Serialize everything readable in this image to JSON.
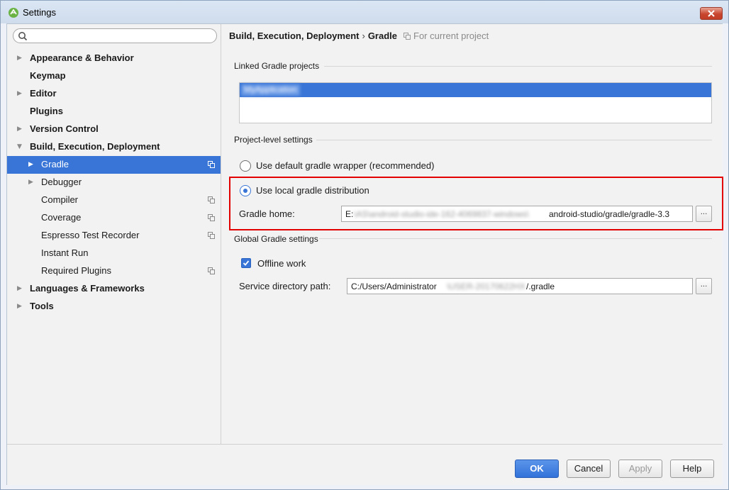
{
  "window": {
    "title": "Settings"
  },
  "search": {
    "placeholder": ""
  },
  "sidebar": {
    "items": [
      {
        "label": "Appearance & Behavior",
        "arrow": "▶"
      },
      {
        "label": "Keymap",
        "arrow": ""
      },
      {
        "label": "Editor",
        "arrow": "▶"
      },
      {
        "label": "Plugins",
        "arrow": ""
      },
      {
        "label": "Version Control",
        "arrow": "▶"
      },
      {
        "label": "Build, Execution, Deployment",
        "arrow": "▼"
      },
      {
        "label": "Gradle",
        "arrow": "▶"
      },
      {
        "label": "Debugger",
        "arrow": "▶"
      },
      {
        "label": "Compiler",
        "arrow": ""
      },
      {
        "label": "Coverage",
        "arrow": ""
      },
      {
        "label": "Espresso Test Recorder",
        "arrow": ""
      },
      {
        "label": "Instant Run",
        "arrow": ""
      },
      {
        "label": "Required Plugins",
        "arrow": ""
      },
      {
        "label": "Languages & Frameworks",
        "arrow": "▶"
      },
      {
        "label": "Tools",
        "arrow": "▶"
      }
    ]
  },
  "breadcrumb": {
    "parent": "Build, Execution, Deployment",
    "separator": "›",
    "current": "Gradle",
    "scope": "For current project"
  },
  "linked": {
    "heading": "Linked Gradle projects",
    "project_name": "MyApplication"
  },
  "project_level": {
    "heading": "Project-level settings",
    "option_default": "Use default gradle wrapper (recommended)",
    "option_local": "Use local gradle distribution",
    "gradle_home_label": "Gradle home:",
    "gradle_home_prefix": "E:",
    "gradle_home_hidden": "\\AS\\android-studio-ide-162-4069837-windows\\",
    "gradle_home_suffix": "android-studio/gradle/gradle-3.3"
  },
  "global": {
    "heading": "Global Gradle settings",
    "offline_label": "Offline work",
    "service_label": "Service directory path:",
    "service_prefix": "C:/Users/Administrator",
    "service_hidden": "\\USER-20170622HX",
    "service_suffix": "/.gradle"
  },
  "browse_label": "...",
  "footer": {
    "ok": "OK",
    "cancel": "Cancel",
    "apply": "Apply",
    "help": "Help"
  },
  "colors": {
    "accent": "#3875d6",
    "highlight": "#e30000"
  }
}
